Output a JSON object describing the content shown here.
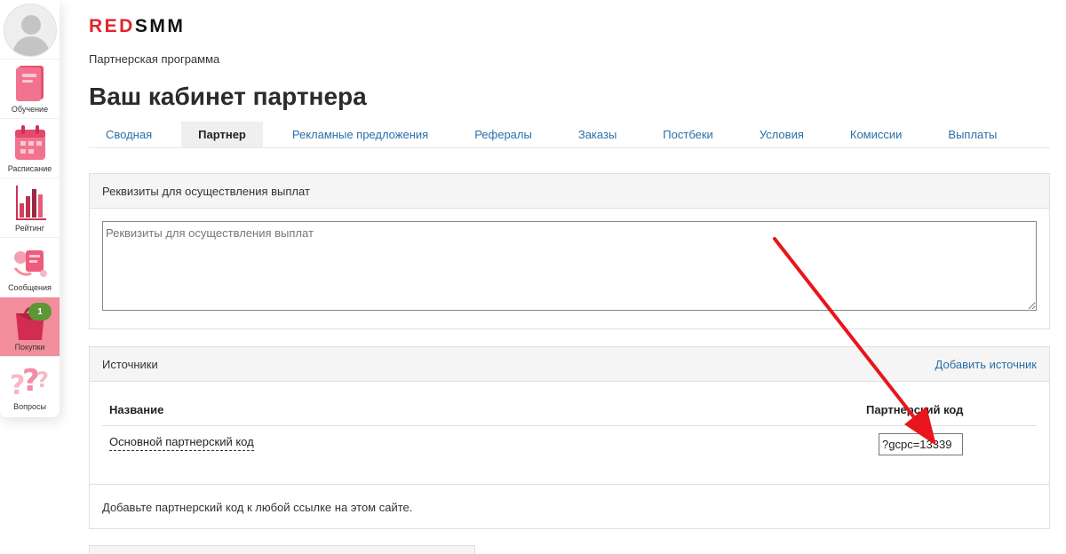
{
  "sidebar": {
    "items": [
      {
        "label": "Обучение",
        "icon": "notebook-icon"
      },
      {
        "label": "Расписание",
        "icon": "calendar-icon"
      },
      {
        "label": "Рейтинг",
        "icon": "bar-chart-icon"
      },
      {
        "label": "Сообщения",
        "icon": "messages-icon"
      },
      {
        "label": "Покупки",
        "icon": "shopping-bag-icon",
        "badge": "1"
      },
      {
        "label": "Вопросы",
        "icon": "question-marks-icon"
      }
    ]
  },
  "brand": {
    "part1": "RED",
    "part2": "SMM",
    "accent": "#e0262b"
  },
  "header": {
    "subtitle": "Партнерская программа",
    "title": "Ваш кабинет партнера"
  },
  "tabs": [
    {
      "label": "Сводная"
    },
    {
      "label": "Партнер",
      "active": true
    },
    {
      "label": "Рекламные предложения"
    },
    {
      "label": "Рефералы"
    },
    {
      "label": "Заказы"
    },
    {
      "label": "Постбеки"
    },
    {
      "label": "Условия"
    },
    {
      "label": "Комиссии"
    },
    {
      "label": "Выплаты"
    }
  ],
  "requisites": {
    "title": "Реквизиты для осуществления выплат",
    "placeholder": "Реквизиты для осуществления выплат",
    "value": ""
  },
  "sources": {
    "title": "Источники",
    "add_link": "Добавить источник",
    "columns": [
      "Название",
      "Партнерский код"
    ],
    "rows": [
      {
        "name": "Основной партнерский код",
        "code": "?gcpc=13339"
      }
    ],
    "note": "Добавьте партнерский код к любой ссылке на этом сайте."
  },
  "colors": {
    "link": "#2a6fa8",
    "active_side": "#f28e9c",
    "badge": "#5d9635",
    "arrow": "#e8161c"
  }
}
